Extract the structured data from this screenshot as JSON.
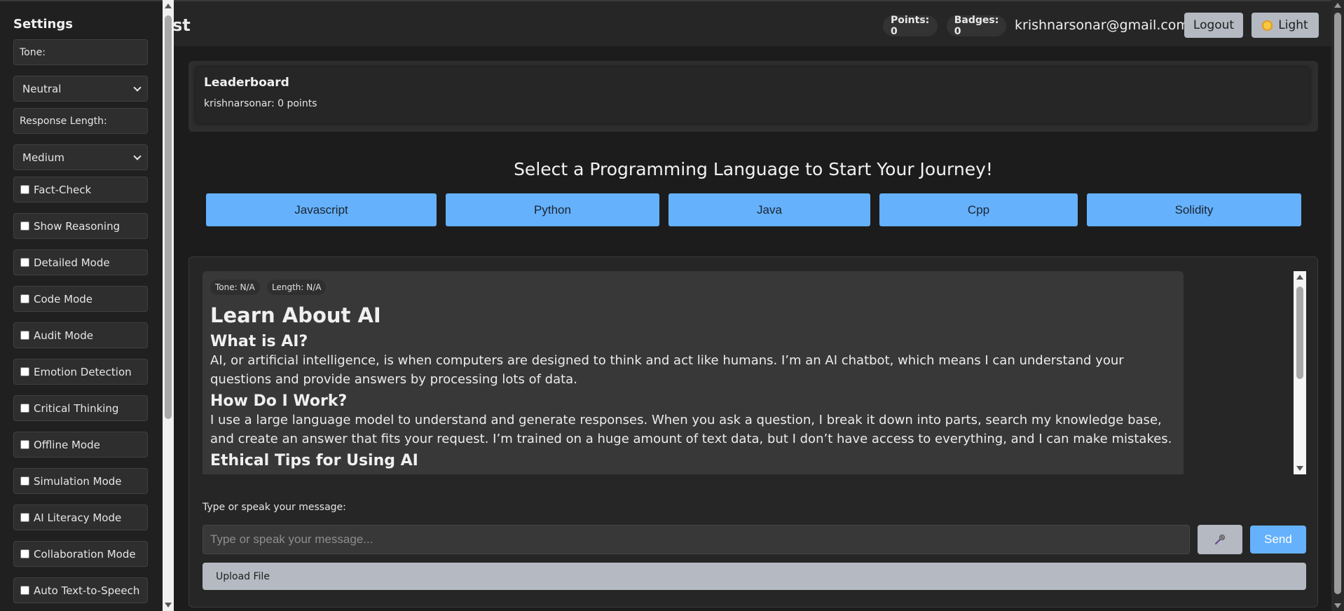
{
  "header": {
    "title_fragment": "st",
    "points_label": "Points: 0",
    "badges_label": "Badges: 0",
    "user_email": "krishnarsonar@gmail.com",
    "logout_label": "Logout",
    "theme_label": "Light",
    "theme_icon": "sun-icon"
  },
  "sidebar": {
    "title": "Settings",
    "tone_label": "Tone:",
    "tone_value": "Neutral",
    "length_label": "Response Length:",
    "length_value": "Medium",
    "checkboxes": [
      "Fact-Check",
      "Show Reasoning",
      "Detailed Mode",
      "Code Mode",
      "Audit Mode",
      "Emotion Detection",
      "Critical Thinking",
      "Offline Mode",
      "Simulation Mode",
      "AI Literacy Mode",
      "Collaboration Mode",
      "Auto Text-to-Speech"
    ]
  },
  "leaderboard": {
    "title": "Leaderboard",
    "entries": [
      "krishnarsonar: 0 points"
    ]
  },
  "languages": {
    "heading": "Select a Programming Language to Start Your Journey!",
    "options": [
      "Javascript",
      "Python",
      "Java",
      "Cpp",
      "Solidity"
    ]
  },
  "chat": {
    "tone_tag": "Tone: N/A",
    "length_tag": "Length: N/A",
    "message": {
      "title": "Learn About AI",
      "sections": [
        {
          "heading": "What is AI?",
          "body": "AI, or artificial intelligence, is when computers are designed to think and act like humans. I’m an AI chatbot, which means I can understand your questions and provide answers by processing lots of data."
        },
        {
          "heading": "How Do I Work?",
          "body": "I use a large language model to understand and generate responses. When you ask a question, I break it down into parts, search my knowledge base, and create an answer that fits your request. I’m trained on a huge amount of text data, but I don’t have access to everything, and I can make mistakes."
        },
        {
          "heading": "Ethical Tips for Using AI",
          "body": ""
        }
      ]
    },
    "input_label": "Type or speak your message:",
    "input_placeholder": "Type or speak your message...",
    "input_value": "",
    "mic_icon": "microphone-icon",
    "send_label": "Send",
    "upload_label": "Upload File"
  },
  "colors": {
    "accent": "#65b1fc",
    "background": "#1c1c1c",
    "panel": "#262626",
    "button_grey": "#b4b9c2"
  }
}
